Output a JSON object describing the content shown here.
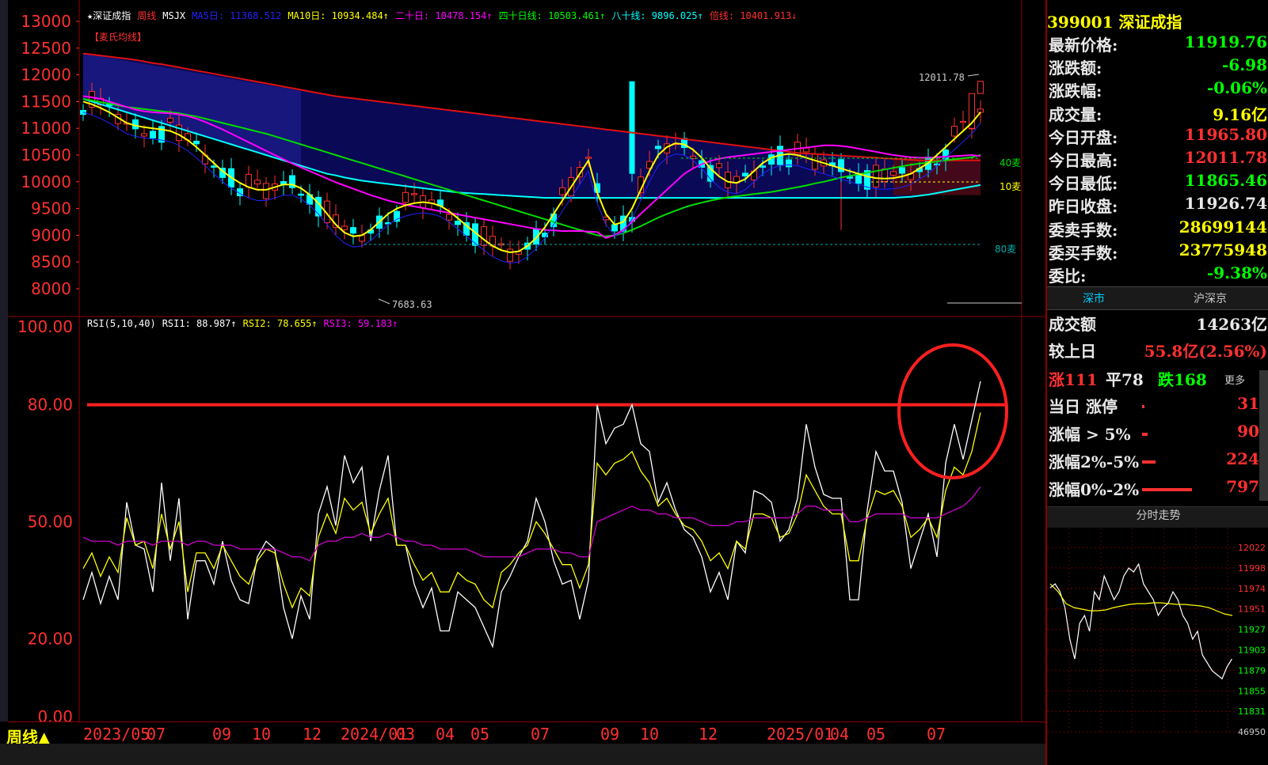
{
  "header": {
    "star_title": "★深证成指",
    "period": "周线",
    "indicator": "MSJX",
    "ma5": "MA5日: 11368.512",
    "ma10": "MA10日: 10934.484↑",
    "ma20": "二十日: 10478.154↑",
    "ma40": "四十日线: 10503.461↑",
    "ma80": "八十线: 9896.025↑",
    "double": "倍线: 10401.913↓",
    "overlay_tag": "【麦氏均线】"
  },
  "price_axis": [
    "13000",
    "12500",
    "12000",
    "11500",
    "11000",
    "10500",
    "10000",
    "9500",
    "9000",
    "8500",
    "8000"
  ],
  "annotations": {
    "high": "12011.78",
    "low": "7683.63",
    "label_40": "40麦",
    "label_10": "10麦",
    "label_80": "80麦"
  },
  "rsi": {
    "title": "RSI(5,10,40)",
    "rsi1": "RSI1: 88.987↑",
    "rsi2": "RSI2: 78.655↑",
    "rsi3": "RSI3: 59.183↑",
    "axis": [
      "100.00",
      "80.00",
      "50.00",
      "20.00",
      "0.00"
    ]
  },
  "bottom": {
    "period_label": "周线▲",
    "dates": [
      "2023/05",
      "07",
      "09",
      "10",
      "12",
      "2024/01",
      "03",
      "04",
      "05",
      "07",
      "09",
      "10",
      "12",
      "2025/01",
      "04",
      "05",
      "07"
    ]
  },
  "quote": {
    "code": "399001",
    "name": "深证成指",
    "rows": [
      {
        "k": "最新价格:",
        "v": "11919.76",
        "color": "#00ff00"
      },
      {
        "k": "涨跌额:",
        "v": "-6.98",
        "color": "#00ff00"
      },
      {
        "k": "涨跌幅:",
        "v": "-0.06%",
        "color": "#00ff00"
      },
      {
        "k": "成交量:",
        "v": "9.16亿",
        "color": "#ffff00"
      },
      {
        "k": "今日开盘:",
        "v": "11965.80",
        "color": "#ff3030"
      },
      {
        "k": "今日最高:",
        "v": "12011.78",
        "color": "#ff3030"
      },
      {
        "k": "今日最低:",
        "v": "11865.46",
        "color": "#00ff00"
      },
      {
        "k": "昨日收盘:",
        "v": "11926.74",
        "color": "#e8e8e8"
      },
      {
        "k": "委卖手数:",
        "v": "28699144",
        "color": "#ffff00"
      },
      {
        "k": "委买手数:",
        "v": "23775948",
        "color": "#ffff00"
      },
      {
        "k": "委比:",
        "v": "-9.38%",
        "color": "#00ff00"
      }
    ]
  },
  "tabs": {
    "left": "深市",
    "right": "沪深京"
  },
  "stats": {
    "turnover_k": "成交额",
    "turnover_v": "14263亿",
    "vs_prev_k": "较上日",
    "vs_prev_v": "55.8亿(2.56%)",
    "up": "涨111",
    "flat": "平78",
    "down": "跌168",
    "more": "更多",
    "rows": [
      {
        "k": "当日 涨停",
        "v": "31",
        "bar": 0.02
      },
      {
        "k": "涨幅 > 5%",
        "v": "90",
        "bar": 0.05
      },
      {
        "k": "涨幅2%-5%",
        "v": "224",
        "bar": 0.12
      },
      {
        "k": "涨幅0%-2%",
        "v": "797",
        "bar": 0.45
      }
    ]
  },
  "intraday": {
    "title": "分时走势",
    "axis": [
      "12022",
      "11998",
      "11974",
      "11951",
      "11927",
      "11903",
      "11879",
      "11855",
      "11831",
      "46950"
    ]
  },
  "colors": {
    "up": "#ff3030",
    "down": "#00ffff",
    "ma5": "#ffffff",
    "ma10": "#ffff00",
    "ma20": "#ff00ff",
    "ma40": "#00ff00",
    "ma80": "#00ffff",
    "double": "#ff3030"
  },
  "chart_data": {
    "type": "line",
    "title": "RSI(5,10,40)",
    "ylim": [
      0,
      100
    ],
    "series": [
      {
        "name": "RSI1",
        "values": [
          30,
          37,
          29,
          36,
          30,
          55,
          44,
          43,
          32,
          60,
          40,
          56,
          25,
          40,
          40,
          34,
          45,
          35,
          30,
          29,
          41,
          45,
          43,
          28,
          20,
          31,
          25,
          52,
          59,
          49,
          67,
          60,
          64,
          45,
          58,
          67,
          44,
          44,
          34,
          28,
          33,
          22,
          22,
          32,
          30,
          28,
          23,
          18,
          32,
          36,
          41,
          45,
          56,
          50,
          40,
          34,
          35,
          25,
          35,
          80,
          70,
          74,
          75,
          80,
          70,
          68,
          55,
          60,
          53,
          48,
          46,
          41,
          32,
          37,
          30,
          45,
          42,
          58,
          57,
          55,
          45,
          48,
          56,
          75,
          64,
          57,
          56,
          56,
          30,
          30,
          53,
          68,
          63,
          63,
          55,
          38,
          45,
          52,
          41,
          65,
          75,
          66,
          76,
          86
        ]
      },
      {
        "name": "RSI2",
        "values": [
          38,
          42,
          36,
          41,
          37,
          51,
          44,
          45,
          38,
          52,
          43,
          50,
          32,
          42,
          42,
          38,
          44,
          40,
          36,
          34,
          40,
          43,
          42,
          34,
          28,
          33,
          31,
          46,
          52,
          47,
          56,
          53,
          55,
          47,
          52,
          56,
          44,
          44,
          39,
          35,
          37,
          32,
          32,
          37,
          35,
          34,
          30,
          28,
          37,
          39,
          42,
          44,
          50,
          47,
          43,
          39,
          39,
          33,
          39,
          65,
          62,
          65,
          66,
          68,
          63,
          60,
          54,
          56,
          52,
          49,
          48,
          45,
          40,
          42,
          38,
          45,
          43,
          52,
          52,
          51,
          46,
          47,
          52,
          62,
          58,
          54,
          52,
          52,
          40,
          40,
          51,
          58,
          57,
          58,
          54,
          46,
          48,
          51,
          46,
          58,
          64,
          62,
          68,
          78
        ]
      },
      {
        "name": "RSI3",
        "values": [
          46,
          45,
          45,
          45,
          44,
          45,
          45,
          45,
          44,
          45,
          45,
          45,
          44,
          45,
          45,
          44,
          44,
          44,
          43,
          43,
          43,
          43,
          43,
          42,
          41,
          41,
          40,
          44,
          45,
          45,
          46,
          46,
          47,
          46,
          46,
          47,
          46,
          45,
          45,
          44,
          44,
          43,
          43,
          43,
          43,
          42,
          41,
          41,
          41,
          41,
          41,
          42,
          43,
          43,
          43,
          42,
          42,
          41,
          41,
          50,
          51,
          52,
          53,
          54,
          53,
          53,
          52,
          52,
          51,
          51,
          51,
          50,
          49,
          49,
          49,
          50,
          50,
          51,
          51,
          51,
          51,
          51,
          52,
          54,
          54,
          53,
          53,
          53,
          50,
          50,
          51,
          52,
          52,
          52,
          52,
          51,
          51,
          51,
          51,
          52,
          53,
          54,
          56,
          59
        ]
      }
    ]
  }
}
